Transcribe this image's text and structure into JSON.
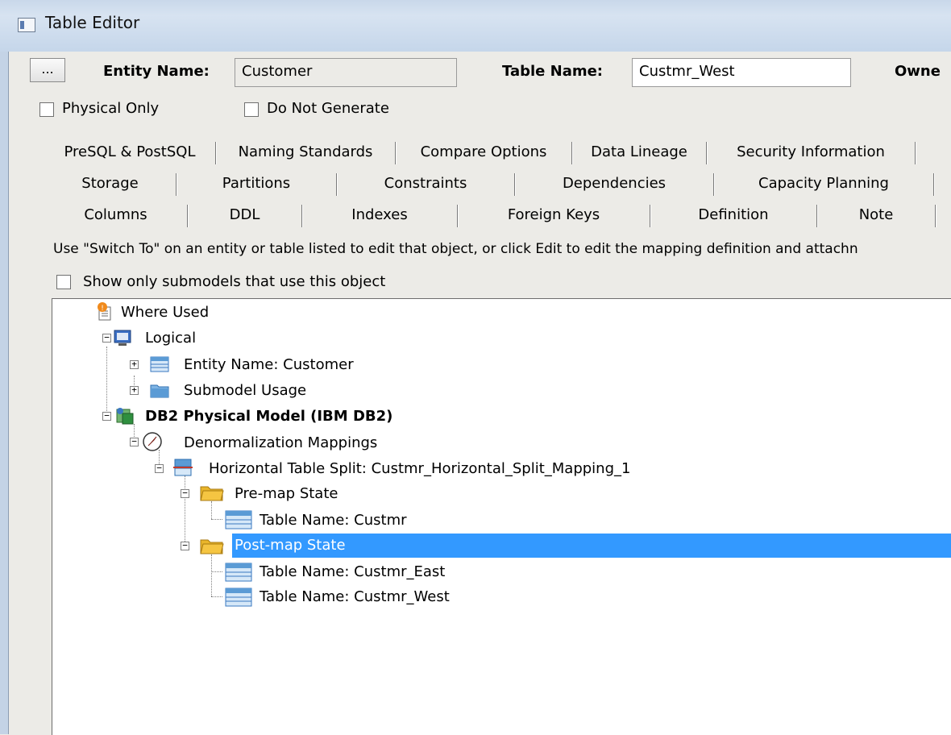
{
  "window": {
    "title": "Table Editor"
  },
  "header": {
    "ellipsis_button": "...",
    "entity_name_label": "Entity Name:",
    "entity_name_value": "Customer",
    "table_name_label": "Table Name:",
    "table_name_value": "Custmr_West",
    "owner_label": "Owne"
  },
  "options": {
    "physical_only": "Physical Only",
    "do_not_generate": "Do Not Generate"
  },
  "tabs": {
    "row1": [
      "PreSQL & PostSQL",
      "Naming Standards",
      "Compare Options",
      "Data Lineage",
      "Security Information"
    ],
    "row2": [
      "Storage",
      "Partitions",
      "Constraints",
      "Dependencies",
      "Capacity Planning"
    ],
    "row3": [
      "Columns",
      "DDL",
      "Indexes",
      "Foreign Keys",
      "Definition",
      "Note"
    ]
  },
  "panel": {
    "hint": "Use \"Switch To\" on an entity or table listed to edit that object, or click Edit to edit the mapping definition and attachn",
    "show_submodels": "Show only submodels that use this object"
  },
  "tree": {
    "root": "Where Used",
    "logical": "Logical",
    "entity": "Entity Name: Customer",
    "submodel": "Submodel Usage",
    "physical": "DB2 Physical Model (IBM DB2)",
    "denorm": "Denormalization Mappings",
    "split": "Horizontal Table Split: Custmr_Horizontal_Split_Mapping_1",
    "premap": "Pre-map State",
    "pre_table": "Table Name: Custmr",
    "postmap": "Post-map State",
    "post_table_1": "Table Name: Custmr_East",
    "post_table_2": "Table Name: Custmr_West"
  },
  "colors": {
    "selection": "#3399ff",
    "folder": "#f5c542",
    "table": "#5b9bd5"
  }
}
